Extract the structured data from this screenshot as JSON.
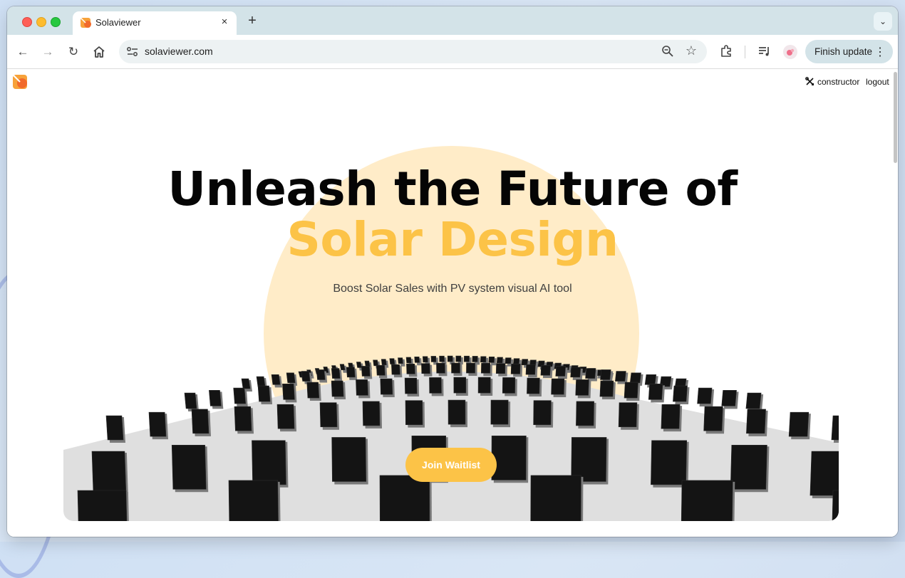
{
  "browser": {
    "tab": {
      "title": "Solaviewer",
      "close_glyph": "×",
      "favicon": "solaviewer-logo-icon"
    },
    "new_tab_glyph": "+",
    "tab_search_glyph": "⌄",
    "address": {
      "url": "solaviewer.com"
    },
    "finish_update": {
      "label": "Finish update",
      "menu_glyph": "⋮"
    },
    "icons": [
      "back-icon",
      "forward-icon",
      "reload-icon",
      "home-icon",
      "site-info-icon",
      "zoom-icon",
      "bookmark-star-icon",
      "extensions-icon",
      "media-queue-icon",
      "profile-icon"
    ]
  },
  "page": {
    "nav": {
      "constructor_label": "constructor",
      "logout_label": "logout"
    },
    "hero": {
      "title_line1": "Unleash the Future of",
      "title_line2": "Solar Design",
      "subtitle": "Boost Solar Sales with PV system visual AI tool",
      "cta_label": "Join Waitlist"
    },
    "colors": {
      "accent": "#fcc347",
      "sun": "#ffecc8",
      "ground": "#dfdfdf",
      "panel": "#141414"
    }
  }
}
